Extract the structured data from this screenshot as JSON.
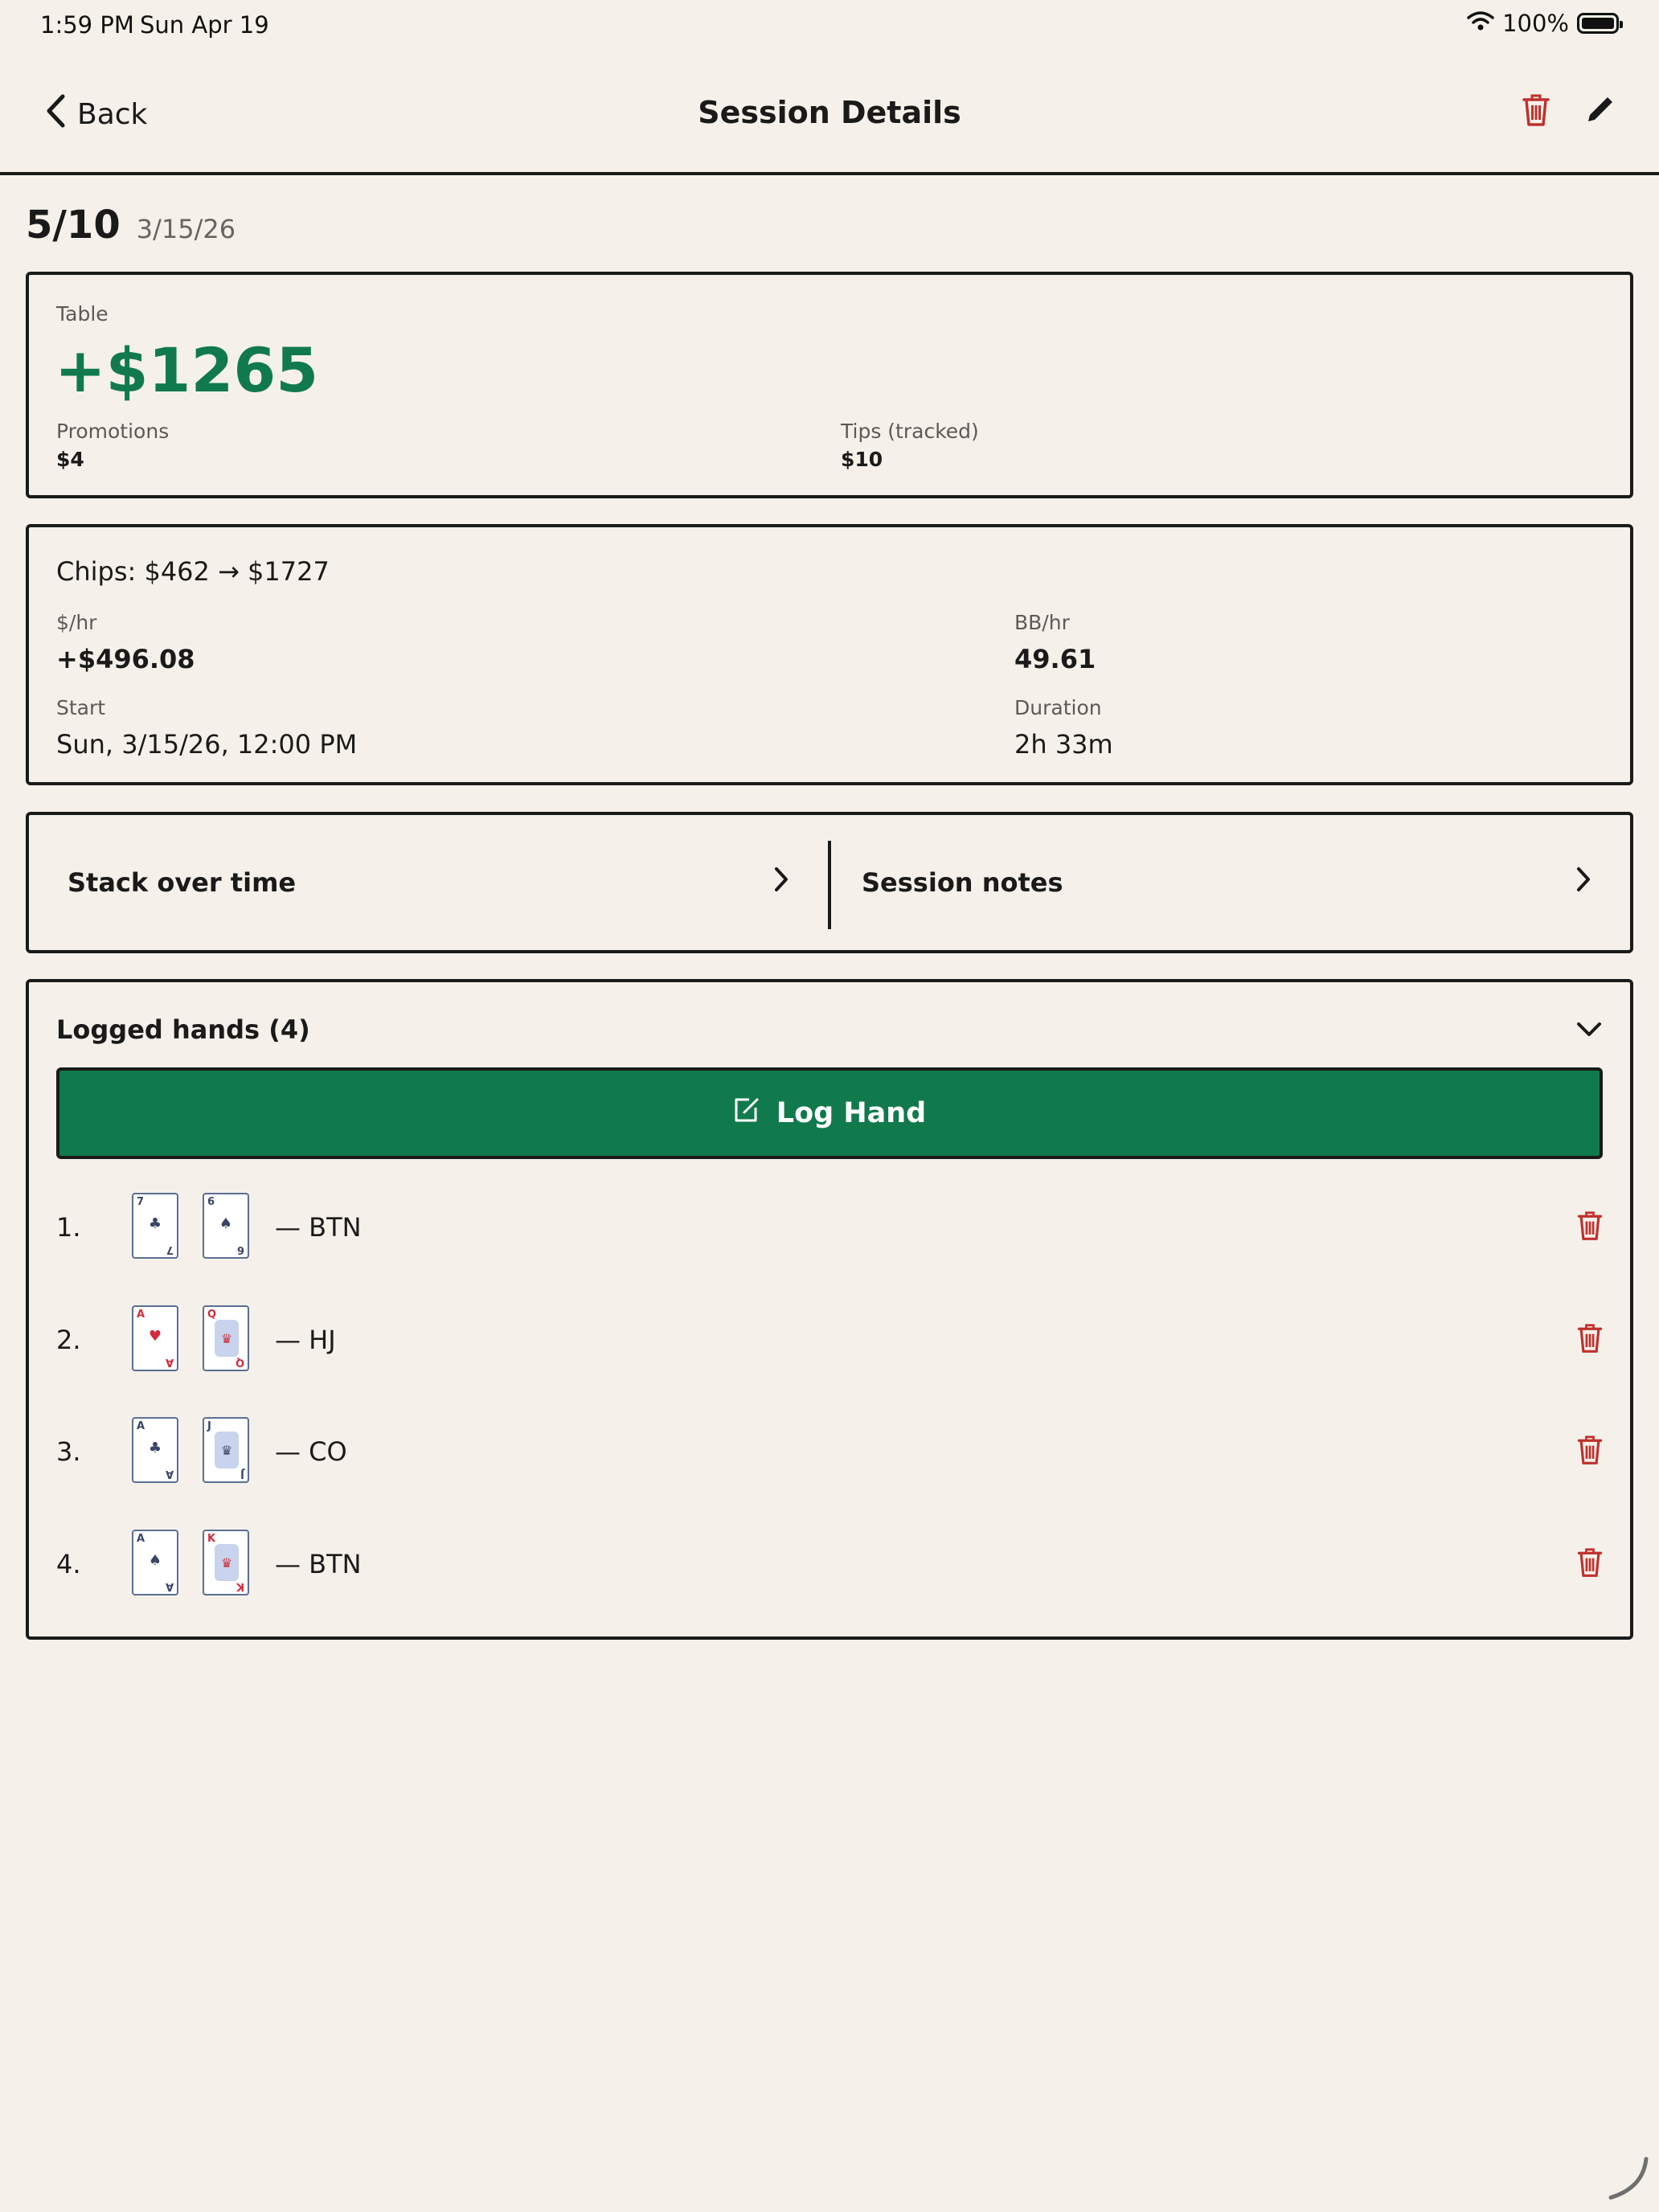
{
  "status_bar": {
    "time": "1:59 PM",
    "date": "Sun Apr 19",
    "battery": "100%"
  },
  "nav": {
    "back_label": "Back",
    "title": "Session Details"
  },
  "session": {
    "stakes": "5/10",
    "date": "3/15/26"
  },
  "result": {
    "table_label": "Table",
    "profit": "+$1265",
    "promotions_label": "Promotions",
    "promotions_value": "$4",
    "tips_label": "Tips (tracked)",
    "tips_value": "$10"
  },
  "stats": {
    "chips": "Chips: $462 → $1727",
    "hourly_label": "$/hr",
    "hourly_value": "+$496.08",
    "bbhr_label": "BB/hr",
    "bbhr_value": "49.61",
    "start_label": "Start",
    "start_value": "Sun, 3/15/26, 12:00 PM",
    "duration_label": "Duration",
    "duration_value": "2h 33m"
  },
  "links": {
    "stack": "Stack over time",
    "notes": "Session notes"
  },
  "hands": {
    "title": "Logged hands (4)",
    "log_button": "Log Hand",
    "items": [
      {
        "num": "1.",
        "position": "— BTN",
        "card1": {
          "rank": "7",
          "suit": "♣",
          "color": "black"
        },
        "card2": {
          "rank": "6",
          "suit": "♠",
          "color": "black"
        }
      },
      {
        "num": "2.",
        "position": "— HJ",
        "card1": {
          "rank": "A",
          "suit": "♥",
          "color": "red"
        },
        "card2": {
          "rank": "Q",
          "suit": "♥",
          "color": "red"
        }
      },
      {
        "num": "3.",
        "position": "— CO",
        "card1": {
          "rank": "A",
          "suit": "♣",
          "color": "black"
        },
        "card2": {
          "rank": "J",
          "suit": "♣",
          "color": "black"
        }
      },
      {
        "num": "4.",
        "position": "— BTN",
        "card1": {
          "rank": "A",
          "suit": "♠",
          "color": "black"
        },
        "card2": {
          "rank": "K",
          "suit": "♦",
          "color": "red"
        }
      }
    ]
  },
  "colors": {
    "accent_green": "#117a4d",
    "delete_red": "#c0302c",
    "background": "#f5f1ea"
  }
}
